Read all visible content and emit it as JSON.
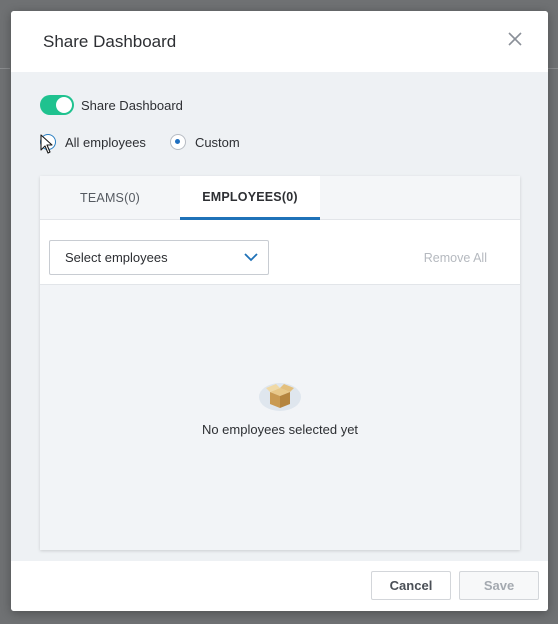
{
  "dialog": {
    "title": "Share Dashboard",
    "close_icon": "close-icon"
  },
  "share_toggle": {
    "label": "Share Dashboard",
    "on": true,
    "color": "#1fc28f"
  },
  "scope": {
    "options": [
      {
        "label": "All employees",
        "checked": false
      },
      {
        "label": "Custom",
        "checked": true
      }
    ]
  },
  "tabs": [
    {
      "label": "TEAMS(0)",
      "active": false
    },
    {
      "label": "EMPLOYEES(0)",
      "active": true
    }
  ],
  "employee_select": {
    "value": "Select employees",
    "icon": "chevron-down-icon"
  },
  "remove_all_label": "Remove All",
  "empty_state": {
    "icon": "empty-box-icon",
    "text": "No employees selected yet"
  },
  "footer": {
    "cancel_label": "Cancel",
    "save_label": "Save"
  },
  "colors": {
    "accent": "#1f72b8",
    "toggle_on": "#1fc28f"
  }
}
